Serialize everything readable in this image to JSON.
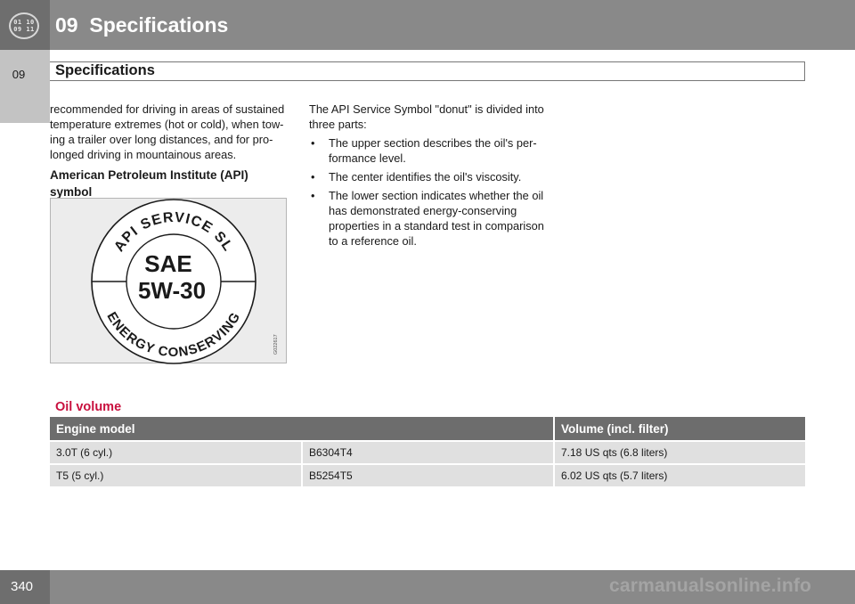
{
  "header": {
    "chapter_badge_lines": [
      "01 10",
      "09 11"
    ],
    "chapter_title": "09  Specifications",
    "side_tab_label": "09",
    "section_title": "Specifications"
  },
  "col1": {
    "paragraph": "recommended for driving in areas of sustained temperature extremes (hot or cold), when tow-ing a trailer over long distances, and for pro-longed driving in mountainous areas.",
    "heading": "American Petroleum Institute (API) symbol"
  },
  "api_symbol": {
    "top_arc": "API SERVICE SL",
    "center_line1": "SAE",
    "center_line2": "5W-30",
    "bottom_arc": "ENERGY CONSERVING",
    "figure_code": "G022617"
  },
  "col2": {
    "intro": "The API Service Symbol \"donut\" is divided into three parts:",
    "bullet_glyph": "•",
    "bullets": [
      "The upper section describes the oil's per-formance level.",
      "The center identifies the oil's viscosity.",
      "The lower section indicates whether the oil has demonstrated energy-conserving properties in a standard test in comparison to a reference oil."
    ]
  },
  "oil_volume": {
    "heading": "Oil volume",
    "columns": [
      "Engine model",
      "Volume (incl. filter)"
    ],
    "rows": [
      {
        "model": "3.0T (6 cyl.)",
        "code": "B6304T4",
        "volume": "7.18 US qts (6.8 liters)"
      },
      {
        "model": "T5 (5 cyl.)",
        "code": "B5254T5",
        "volume": "6.02 US qts (5.7 liters)"
      }
    ]
  },
  "footer": {
    "page_number": "340",
    "watermark": "carmanualsonline.info"
  }
}
